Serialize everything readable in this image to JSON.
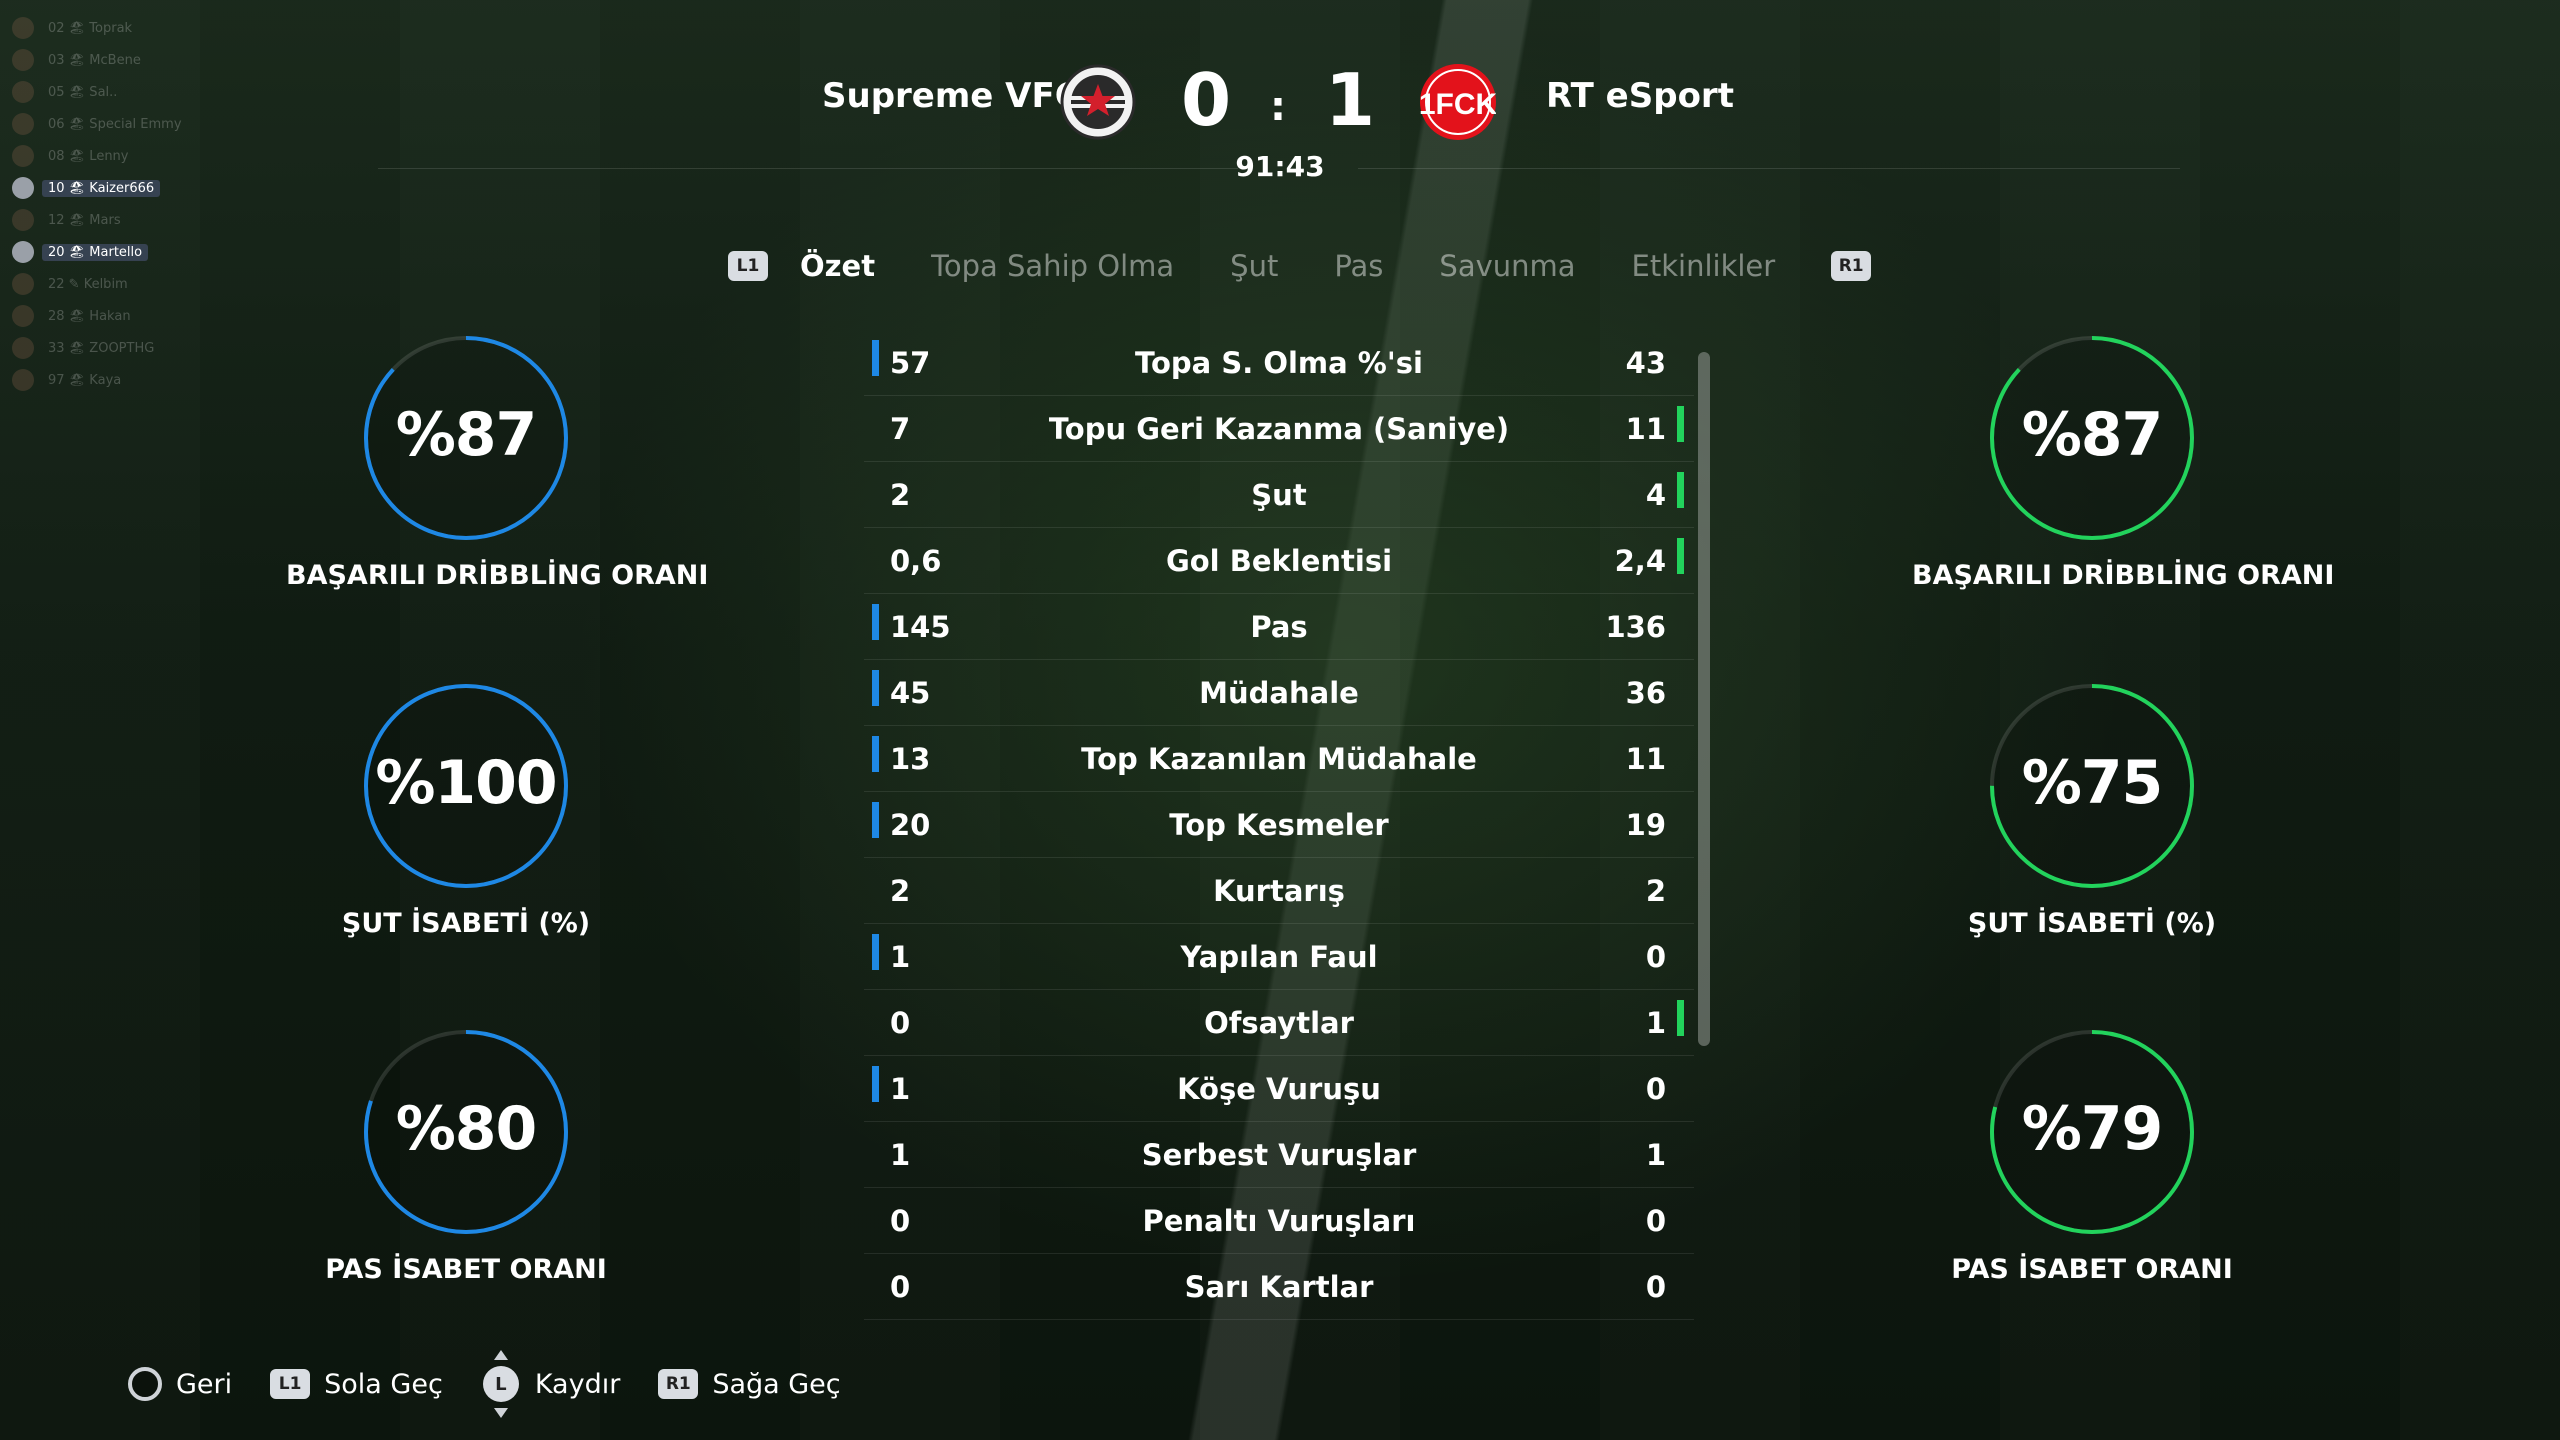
{
  "player_list": [
    {
      "label": "02 🏖 Toprak",
      "active": false
    },
    {
      "label": "03 🏖 McBene",
      "active": false
    },
    {
      "label": "05 🏖 Sal..",
      "active": false
    },
    {
      "label": "06 🏖 Special Emmy",
      "active": false
    },
    {
      "label": "08 🏖 Lenny",
      "active": false
    },
    {
      "label": "10 🏖 Kaizer666",
      "active": true
    },
    {
      "label": "12 🏖 Mars",
      "active": false
    },
    {
      "label": "20 🏖 Martello",
      "active": true
    },
    {
      "label": "22 ✎ Kelbim",
      "active": false
    },
    {
      "label": "28 🏖 Hakan",
      "active": false
    },
    {
      "label": "33 🏖 ZOOPTHG",
      "active": false
    },
    {
      "label": "97 🏖 Kaya",
      "active": false
    }
  ],
  "match": {
    "home_team": "Supreme VFC",
    "away_team": "RT eSport",
    "home_score": "0",
    "away_score": "1",
    "separator": ":",
    "time": "91:43",
    "home_crest_icon": "star-crest-icon",
    "away_crest_icon": "fck-crest-icon",
    "away_crest_text": "1FCK"
  },
  "tabs": {
    "left_button": "L1",
    "right_button": "R1",
    "items": [
      "Özet",
      "Topa Sahip Olma",
      "Şut",
      "Pas",
      "Savunma",
      "Etkinlikler"
    ],
    "active_index": 0
  },
  "colors": {
    "home_accent": "#1e88e5",
    "away_accent": "#22d35c"
  },
  "home_gauges": [
    {
      "value": "%87",
      "percent": 87,
      "label": "BAŞARILI DRİBBLİNG ORANI"
    },
    {
      "value": "%100",
      "percent": 100,
      "label": "ŞUT İSABETİ (%)"
    },
    {
      "value": "%80",
      "percent": 80,
      "label": "PAS İSABET ORANI"
    }
  ],
  "away_gauges": [
    {
      "value": "%87",
      "percent": 87,
      "label": "BAŞARILI DRİBBLİNG ORANI"
    },
    {
      "value": "%75",
      "percent": 75,
      "label": "ŞUT İSABETİ (%)"
    },
    {
      "value": "%79",
      "percent": 79,
      "label": "PAS İSABET ORANI"
    }
  ],
  "stats": [
    {
      "home": "57",
      "label": "Topa S. Olma %'si",
      "away": "43",
      "leader": "home"
    },
    {
      "home": "7",
      "label": "Topu Geri Kazanma (Saniye)",
      "away": "11",
      "leader": "away"
    },
    {
      "home": "2",
      "label": "Şut",
      "away": "4",
      "leader": "away"
    },
    {
      "home": "0,6",
      "label": "Gol Beklentisi",
      "away": "2,4",
      "leader": "away"
    },
    {
      "home": "145",
      "label": "Pas",
      "away": "136",
      "leader": "home"
    },
    {
      "home": "45",
      "label": "Müdahale",
      "away": "36",
      "leader": "home"
    },
    {
      "home": "13",
      "label": "Top Kazanılan Müdahale",
      "away": "11",
      "leader": "home"
    },
    {
      "home": "20",
      "label": "Top Kesmeler",
      "away": "19",
      "leader": "home"
    },
    {
      "home": "2",
      "label": "Kurtarış",
      "away": "2",
      "leader": "none"
    },
    {
      "home": "1",
      "label": "Yapılan Faul",
      "away": "0",
      "leader": "home"
    },
    {
      "home": "0",
      "label": "Ofsaytlar",
      "away": "1",
      "leader": "away"
    },
    {
      "home": "1",
      "label": "Köşe Vuruşu",
      "away": "0",
      "leader": "home"
    },
    {
      "home": "1",
      "label": "Serbest Vuruşlar",
      "away": "1",
      "leader": "none"
    },
    {
      "home": "0",
      "label": "Penaltı Vuruşları",
      "away": "0",
      "leader": "none"
    },
    {
      "home": "0",
      "label": "Sarı Kartlar",
      "away": "0",
      "leader": "none"
    }
  ],
  "footer": {
    "back_label": "Geri",
    "left_button": "L1",
    "left_label": "Sola Geç",
    "stick_button": "L",
    "stick_label": "Kaydır",
    "right_button": "R1",
    "right_label": "Sağa Geç"
  }
}
